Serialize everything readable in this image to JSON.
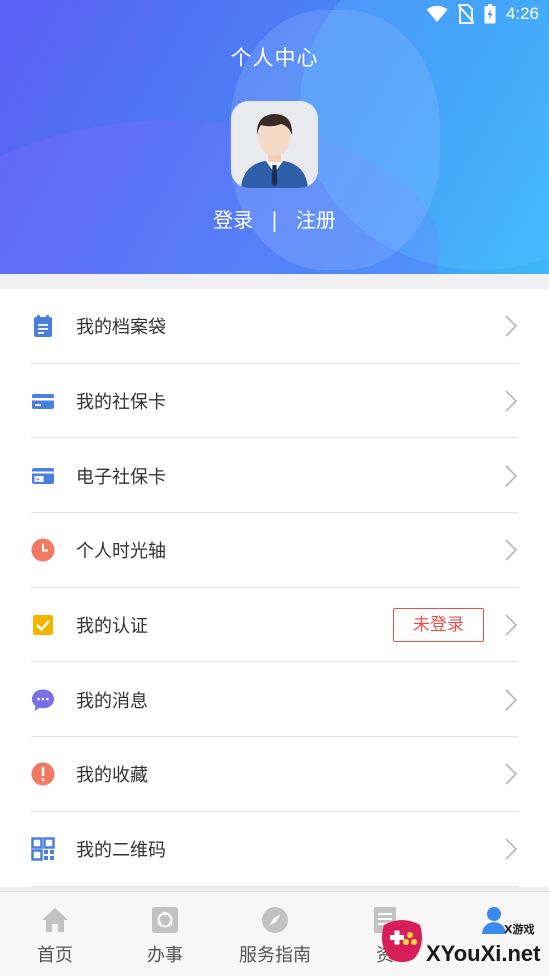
{
  "status_bar": {
    "time": "4:26"
  },
  "header": {
    "title": "个人中心",
    "login_label": "登录",
    "separator": "|",
    "register_label": "注册"
  },
  "menu": {
    "items": [
      {
        "label": "我的档案袋",
        "icon": "clipboard-icon",
        "color": "#4a7fe0"
      },
      {
        "label": "我的社保卡",
        "icon": "card-icon",
        "color": "#4a7fe0"
      },
      {
        "label": "电子社保卡",
        "icon": "ecard-icon",
        "color": "#4a7fe0"
      },
      {
        "label": "个人时光轴",
        "icon": "clock-icon",
        "color": "#f07b62"
      },
      {
        "label": "我的认证",
        "icon": "checkbox-icon",
        "color": "#f4b400",
        "badge": "未登录"
      },
      {
        "label": "我的消息",
        "icon": "chat-bubble-icon",
        "color": "#7a6ee6"
      },
      {
        "label": "我的收藏",
        "icon": "info-icon",
        "color": "#f07b62"
      },
      {
        "label": "我的二维码",
        "icon": "qrcode-icon",
        "color": "#4a7fe0"
      }
    ]
  },
  "bottom_nav": {
    "items": [
      {
        "label": "首页",
        "icon": "home-icon"
      },
      {
        "label": "办事",
        "icon": "service-icon"
      },
      {
        "label": "服务指南",
        "icon": "compass-icon"
      },
      {
        "label": "资",
        "icon": "document-icon"
      },
      {
        "label": "",
        "icon": "person-icon"
      }
    ]
  },
  "watermark": {
    "text": "XYouXi.net",
    "small": "X游戏"
  },
  "colors": {
    "accent_blue": "#4a7fe0",
    "alert_red": "#e8504a"
  }
}
